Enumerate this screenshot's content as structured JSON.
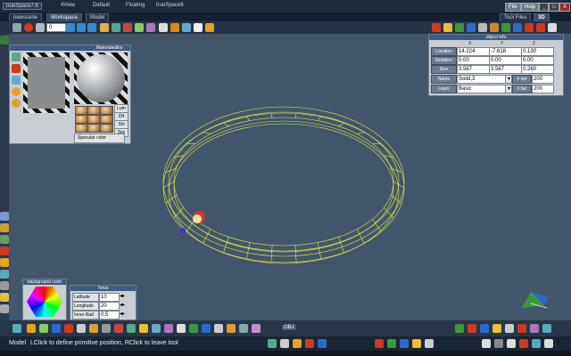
{
  "window": {
    "title": "trueSpace7.6",
    "menus": [
      "4View",
      "Default",
      "Floating",
      "trueSpace6"
    ],
    "right_buttons": [
      "File",
      "Help"
    ],
    "close_label": "X"
  },
  "tabs": {
    "items": [
      "newscene",
      "Workspace",
      "Model"
    ],
    "right_label": "Tool Files",
    "mode_label": "3D"
  },
  "toolbar": {
    "frame_value": "0"
  },
  "object_info": {
    "title": "object info",
    "headers": [
      "X",
      "Y",
      "Z"
    ],
    "rows": [
      {
        "label": "Location",
        "values": [
          "14.224",
          "-7.618",
          "0.130"
        ]
      },
      {
        "label": "Rotation",
        "values": [
          "0.00",
          "0.00",
          "0.00"
        ]
      },
      {
        "label": "Size",
        "values": [
          "3.567",
          "3.567",
          "0.260"
        ]
      }
    ],
    "name_label": "Name",
    "name_value": "Solid,3",
    "layer_label": "Layer",
    "layer_value": "Basic",
    "vert_label": "# ver",
    "vert_value": "200",
    "face_label": "# fac",
    "face_value": "200"
  },
  "material": {
    "title": "Materialeditor",
    "props": [
      "Lum",
      "Dif",
      "Shi",
      "Spc"
    ],
    "specular_label": "Specular color"
  },
  "background": {
    "title": "background color"
  },
  "torus": {
    "title": "Torus",
    "rows": [
      {
        "label": "Latitude",
        "value": "10"
      },
      {
        "label": "Longitude",
        "value": "20"
      },
      {
        "label": "Inner Rad",
        "value": "0.5"
      }
    ]
  },
  "status": {
    "mode": "Model",
    "message": "LClick to define primitive position, RClick to leave tool"
  },
  "bottom_toolbar": {
    "obj_label": "OBJ"
  },
  "colors": {
    "viewport": "#42566b",
    "wireframe": "#e8e84a",
    "accent_red": "#d03a1e",
    "panel_header": "#3f5a80"
  }
}
